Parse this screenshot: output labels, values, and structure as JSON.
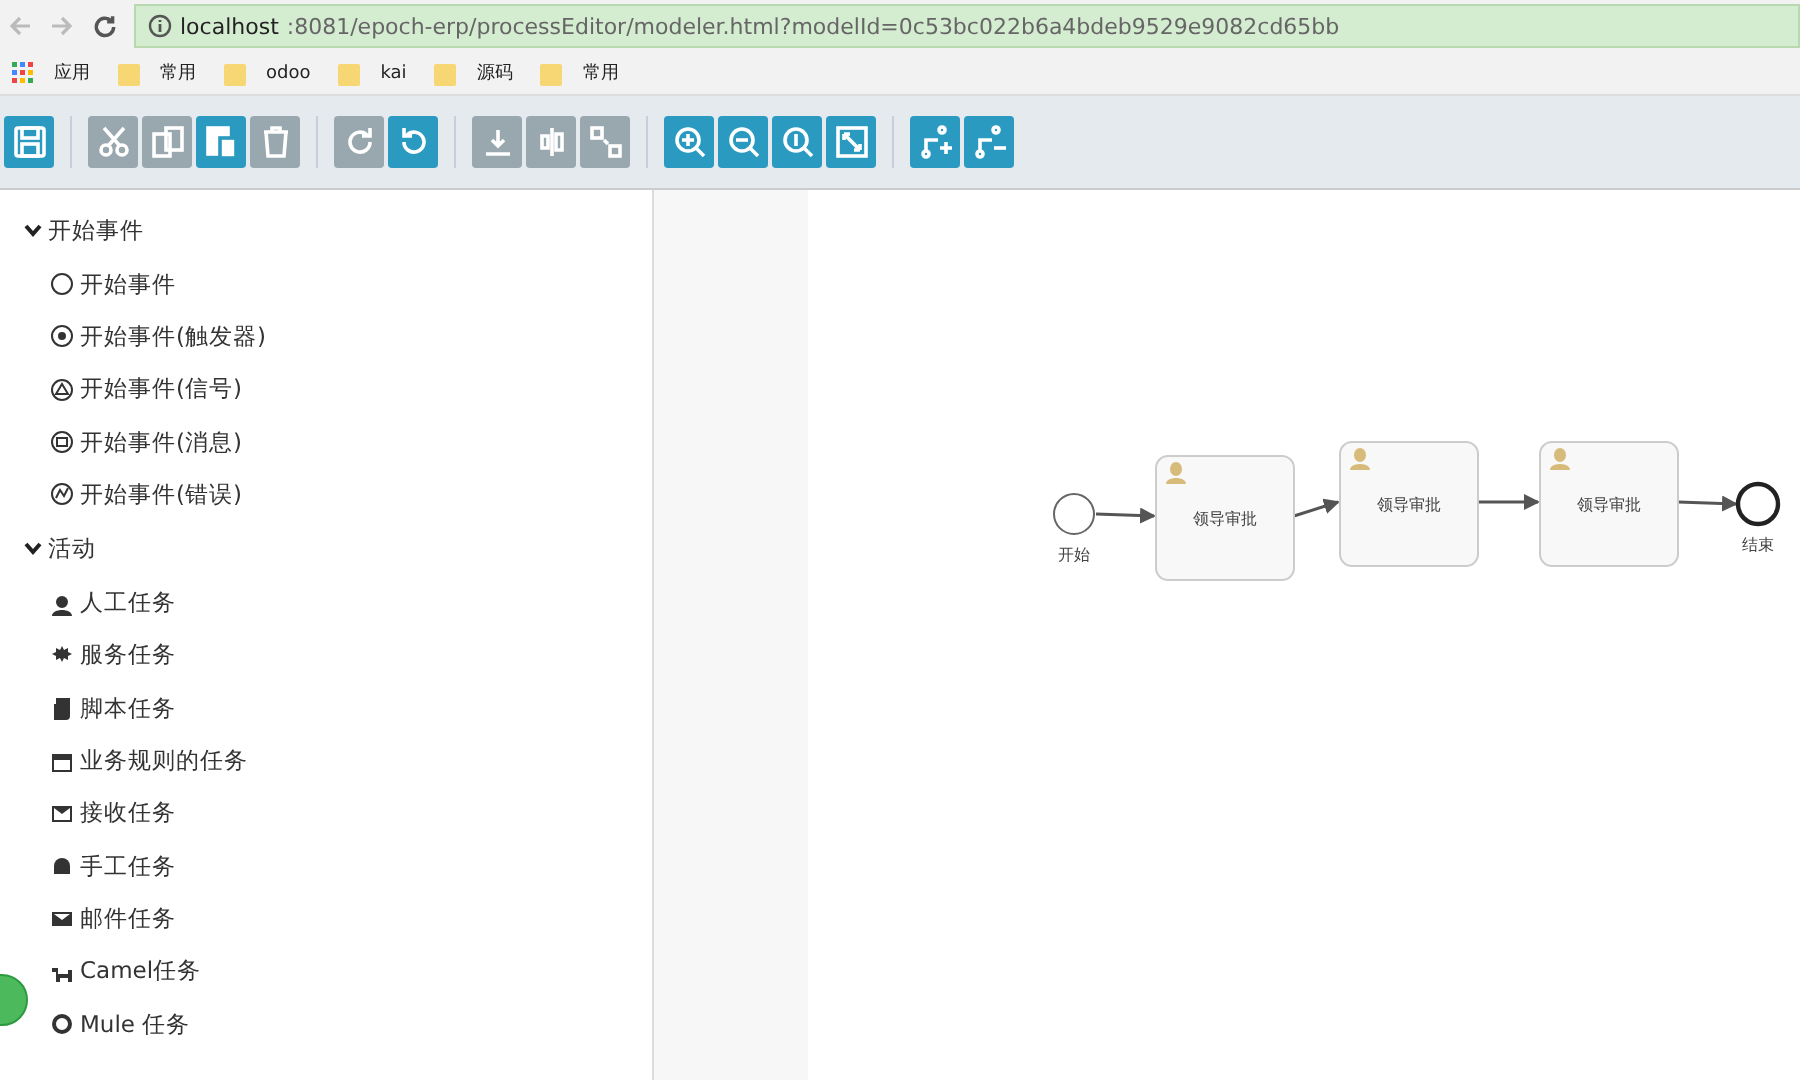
{
  "browser": {
    "url_host": "localhost",
    "url_path": ":8081/epoch-erp/processEditor/modeler.html?modelId=0c53bc022b6a4bdeb9529e9082cd65bb",
    "bookmarks": [
      {
        "kind": "apps",
        "label": "应用"
      },
      {
        "kind": "folder",
        "label": "常用"
      },
      {
        "kind": "folder",
        "label": "odoo"
      },
      {
        "kind": "folder",
        "label": "kai"
      },
      {
        "kind": "folder",
        "label": "源码"
      },
      {
        "kind": "folder",
        "label": "常用"
      }
    ]
  },
  "toolbar": {
    "groups": [
      [
        {
          "disabled": false
        }
      ],
      [
        {
          "disabled": true
        },
        {
          "disabled": true
        },
        {
          "disabled": false
        },
        {
          "disabled": true
        }
      ],
      [
        {
          "disabled": true
        },
        {
          "disabled": false
        }
      ],
      [
        {
          "disabled": true
        },
        {
          "disabled": true
        },
        {
          "disabled": true
        }
      ],
      [
        {
          "disabled": false
        },
        {
          "disabled": false
        },
        {
          "disabled": false
        },
        {
          "disabled": false
        }
      ],
      [
        {
          "disabled": false
        },
        {
          "disabled": false
        }
      ]
    ]
  },
  "palette": [
    {
      "label": "开始事件",
      "expanded": true,
      "items": [
        "开始事件",
        "开始事件(触发器)",
        "开始事件(信号)",
        "开始事件(消息)",
        "开始事件(错误)"
      ]
    },
    {
      "label": "活动",
      "expanded": true,
      "items": [
        "人工任务",
        "服务任务",
        "脚本任务",
        "业务规则的任务",
        "接收任务",
        "手工任务",
        "邮件任务",
        "Camel任务",
        "Mule 任务"
      ]
    }
  ],
  "diagram": {
    "nodes": [
      {
        "kind": "start",
        "label": "开始"
      },
      {
        "kind": "task",
        "label": "领导审批"
      },
      {
        "kind": "task",
        "label": "领导审批"
      },
      {
        "kind": "task",
        "label": "领导审批"
      },
      {
        "kind": "end",
        "label": "结束"
      }
    ]
  }
}
